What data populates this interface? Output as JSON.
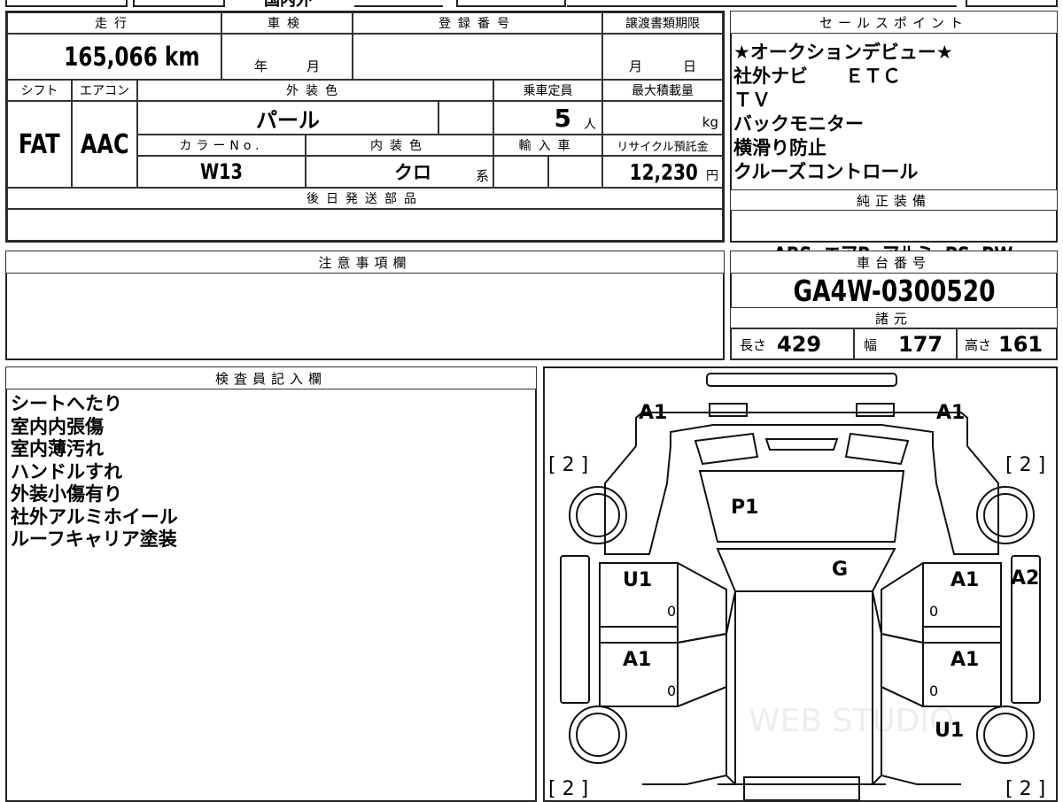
{
  "top_strip": {
    "partial": "国内外",
    "partial2": ""
  },
  "vehicle": {
    "mileage_label": "走行",
    "mileage": "165,066 km",
    "inspection_label": "車検",
    "inspection_year": "年",
    "inspection_month": "月",
    "registration_label": "登録番号",
    "transfer_label": "譲渡書類期限",
    "transfer_month": "月",
    "transfer_day": "日",
    "shift_label": "シフト",
    "shift": "FAT",
    "ac_label": "エアコン",
    "ac": "AAC",
    "exterior_label": "外装色",
    "exterior": "パール",
    "capacity_label": "乗車定員",
    "capacity": "5",
    "capacity_unit": "人",
    "max_load_label": "最大積載量",
    "max_load_unit": "kg",
    "color_no_label": "カラーNo.",
    "color_no": "W13",
    "interior_label": "内装色",
    "interior": "クロ",
    "interior_suffix": "系",
    "import_label": "輸入車",
    "recycle_label": "リサイクル預託金",
    "recycle": "12,230",
    "recycle_unit": "円",
    "later_parts_label": "後日発送部品"
  },
  "sales_points": {
    "label": "セールスポイント",
    "lines": [
      "★オークションデビュー★",
      "社外ナビ　　ＥＴＣ",
      "ＴＶ",
      "バックモニター",
      "横滑り防止",
      "クルーズコントロール"
    ]
  },
  "standard_equipment": {
    "label": "純正装備",
    "items": "ABS  エアB  アルミ  PS  PW"
  },
  "notes": {
    "label": "注意事項欄"
  },
  "chassis": {
    "label": "車台番号",
    "number": "GA4W-0300520"
  },
  "specs": {
    "label": "諸元",
    "length_label": "長さ",
    "length": "429",
    "width_label": "幅",
    "width": "177",
    "height_label": "高さ",
    "height": "161"
  },
  "inspector": {
    "label": "検査員記入欄",
    "lines": [
      "シートへたり",
      "室内内張傷",
      "室内薄汚れ",
      "ハンドルすれ",
      "外装小傷有り",
      "社外アルミホイール",
      "ルーフキャリア塗装"
    ]
  },
  "diagram": {
    "marks": {
      "front_left": "A1",
      "front_right": "A1",
      "bracket_tl": "[ 2 ]",
      "bracket_tr": "[ 2 ]",
      "bracket_bl": "[ 2 ]",
      "bracket_br": "[ 2 ]",
      "hood": "P1",
      "windshield": "G",
      "left_front_door": "U1",
      "right_front_door": "A1",
      "right_side": "A2",
      "left_rear_door": "A1",
      "right_rear_door": "A1",
      "rear_right": "U1",
      "zero1": "0",
      "zero2": "0",
      "zero3": "0",
      "zero4": "0"
    },
    "watermark": "WEB STUDIO"
  }
}
